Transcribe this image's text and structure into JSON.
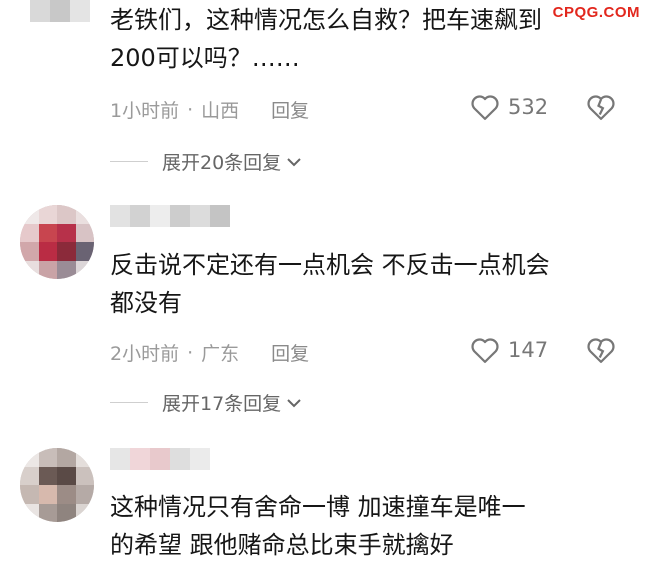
{
  "watermark": "CPQG.COM",
  "comments": [
    {
      "text_line1": "老铁们，这种情况怎么自救？把车速飙到",
      "text_line2": "200可以吗？……",
      "time": "1小时前",
      "region": "山西",
      "reply_label": "回复",
      "likes": "532",
      "expand_label": "展开20条回复"
    },
    {
      "text_line1": "反击说不定还有一点机会  不反击一点机会",
      "text_line2": "都没有",
      "time": "2小时前",
      "region": "广东",
      "reply_label": "回复",
      "likes": "147",
      "expand_label": "展开17条回复"
    },
    {
      "text_line1": "这种情况只有舍命一博    加速撞车是唯一",
      "text_line2": "的希望      跟他赌命总比束手就擒好"
    }
  ],
  "colors": {
    "accent_watermark": "#e2271d",
    "meta_gray": "#9a9a9a",
    "text": "#161616"
  },
  "icons": {
    "like": "heart-outline-icon",
    "dislike": "broken-heart-icon",
    "expand": "chevron-down-icon"
  }
}
